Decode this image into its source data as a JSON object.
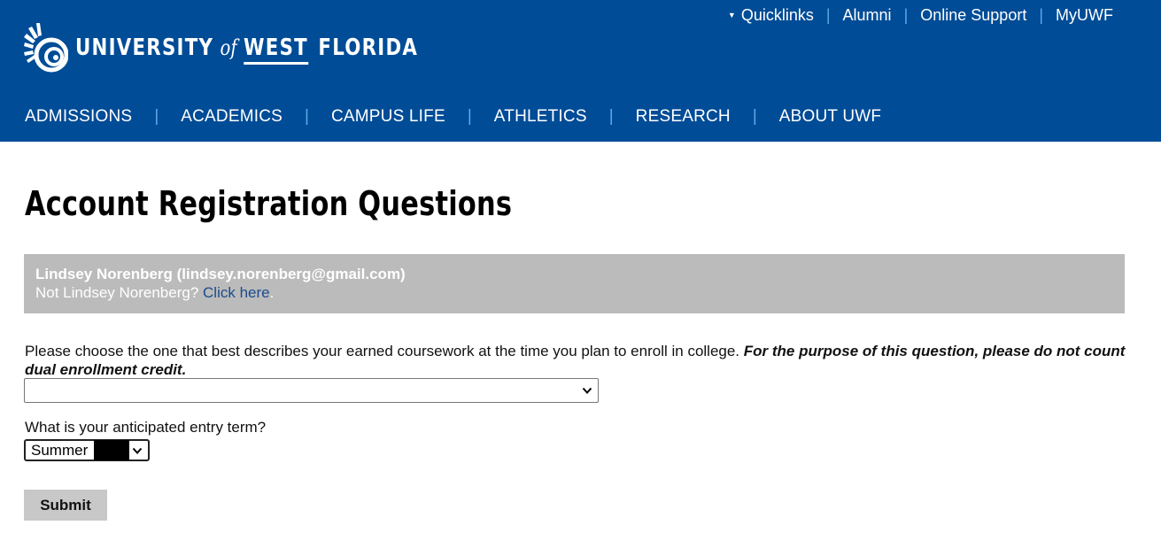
{
  "header": {
    "logo": {
      "university": "UNIVERSITY",
      "of": "of",
      "west": "WEST",
      "florida": "FLORIDA"
    },
    "utility_links": [
      "Quicklinks",
      "Alumni",
      "Online Support",
      "MyUWF"
    ],
    "nav": [
      "ADMISSIONS",
      "ACADEMICS",
      "CAMPUS LIFE",
      "ATHLETICS",
      "RESEARCH",
      "ABOUT UWF"
    ],
    "colors": {
      "background": "#004c97",
      "separator": "#5fa8e8"
    }
  },
  "page": {
    "title": "Account Registration Questions"
  },
  "user_box": {
    "name_email": "Lindsey Norenberg (lindsey.norenberg@gmail.com)",
    "not_user_text": "Not Lindsey Norenberg?",
    "click_here": "Click here",
    "period": "."
  },
  "form": {
    "q1_text": "Please choose the one that best describes your earned coursework at the time you plan to enroll in college.",
    "q1_emphasis": "For the purpose of this question, please do not count dual enrollment credit.",
    "q1_value": "",
    "q2_text": "What is your anticipated entry term?",
    "q2_value": "Summer",
    "submit_label": "Submit"
  }
}
